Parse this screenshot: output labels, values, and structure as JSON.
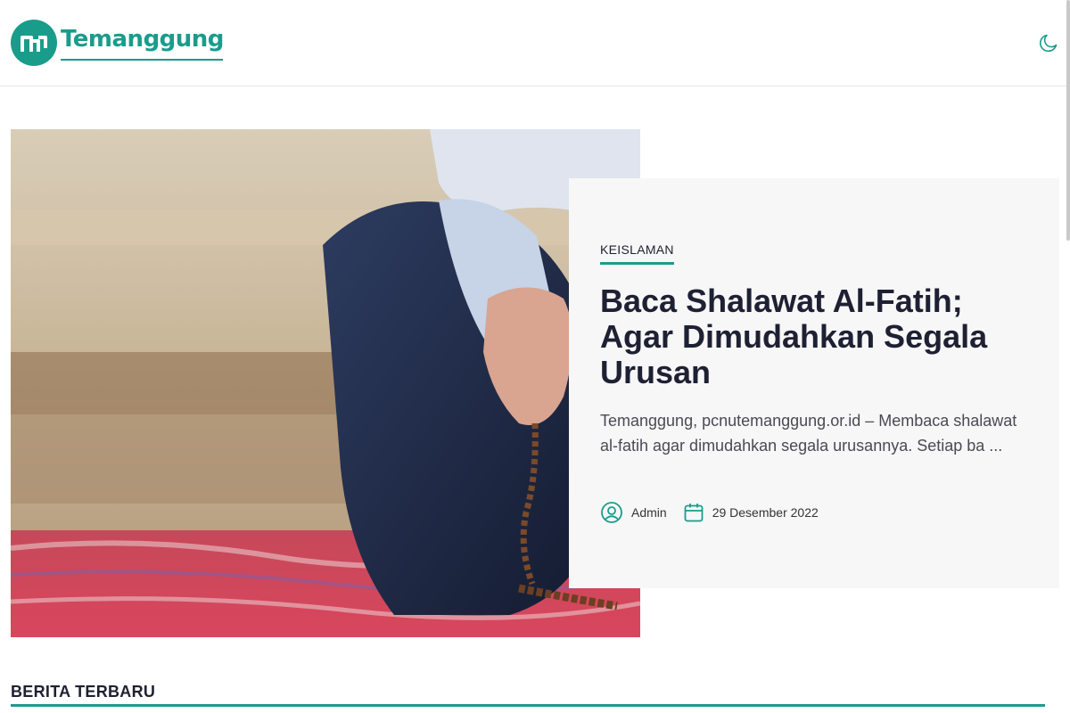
{
  "site": {
    "logo_text": "Temanggung",
    "brand_color": "#1a9c8b",
    "theme_toggle_icon": "moon-icon"
  },
  "featured": {
    "category": "KEISLAMAN",
    "title": "Baca Shalawat Al-Fatih; Agar Dimudahkan Segala Urusan",
    "excerpt": "Temanggung, pcnutemanggung.or.id – Membaca shalawat al-fatih agar dimudahkan segala urusannya. Setiap ba ...",
    "author": "Admin",
    "date": "29 Desember 2022",
    "author_icon": "user-circle-icon",
    "date_icon": "calendar-icon",
    "image_desc": "photo"
  },
  "sections": {
    "latest_title": "BERITA TERBARU"
  }
}
